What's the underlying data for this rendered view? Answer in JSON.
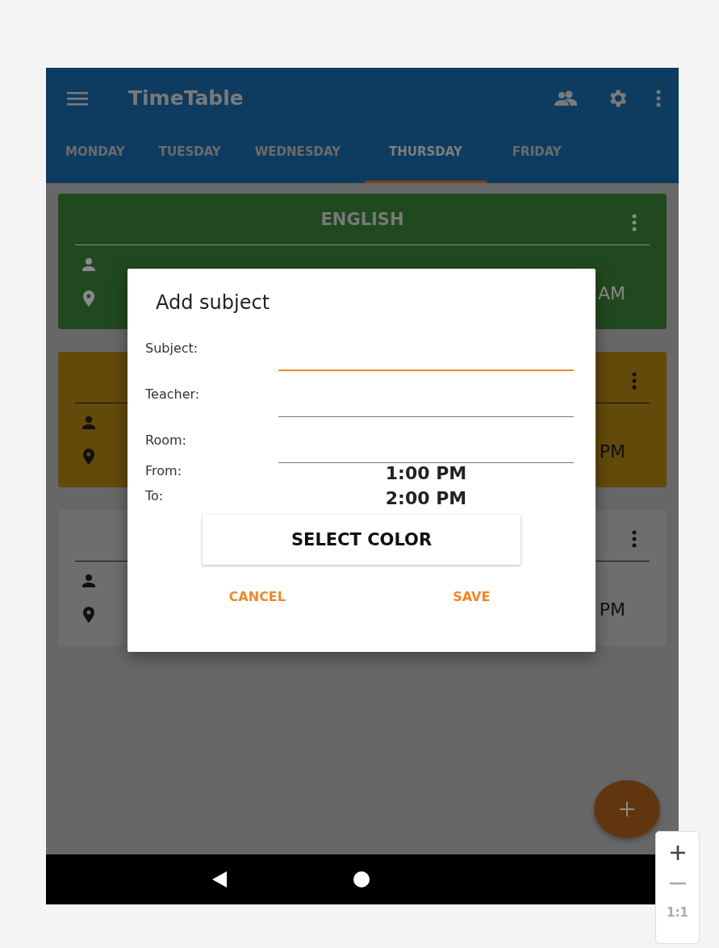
{
  "app_bar": {
    "title": "TimeTable"
  },
  "tabs": [
    {
      "label": "MONDAY",
      "selected": false
    },
    {
      "label": "TUESDAY",
      "selected": false
    },
    {
      "label": "WEDNESDAY",
      "selected": false
    },
    {
      "label": "THURSDAY",
      "selected": true
    },
    {
      "label": "FRIDAY",
      "selected": false
    }
  ],
  "cards": [
    {
      "title": "ENGLISH",
      "time": "AM",
      "color": "#21491f",
      "kind": "light"
    },
    {
      "time": "PM",
      "color": "#634a0a",
      "kind": "dark"
    },
    {
      "time": "PM",
      "color": "#6e6e6e",
      "kind": "dark"
    }
  ],
  "dialog": {
    "title": "Add subject",
    "fields": [
      {
        "label": "Subject:",
        "focused": true
      },
      {
        "label": "Teacher:",
        "focused": false
      },
      {
        "label": "Room:",
        "focused": false
      }
    ],
    "times": [
      {
        "label": "From:",
        "value": "1:00 PM"
      },
      {
        "label": "To:",
        "value": "2:00 PM"
      }
    ],
    "select_color_button": "SELECT COLOR",
    "actions": [
      "CANCEL",
      "SAVE"
    ]
  },
  "zoom_control": {
    "reset_label": "1:1"
  }
}
